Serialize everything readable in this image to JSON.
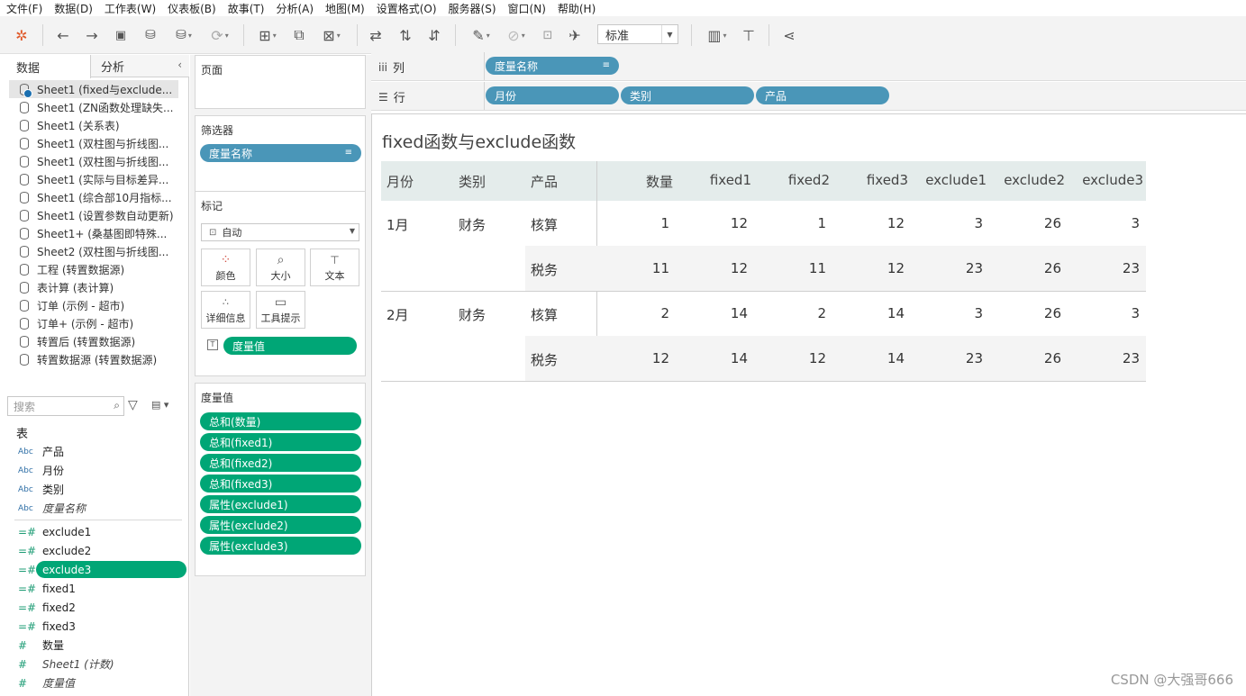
{
  "menu": [
    "文件(F)",
    "数据(D)",
    "工作表(W)",
    "仪表板(B)",
    "故事(T)",
    "分析(A)",
    "地图(M)",
    "设置格式(O)",
    "服务器(S)",
    "窗口(N)",
    "帮助(H)"
  ],
  "toolbar": {
    "fit_label": "标准"
  },
  "left": {
    "tab_data": "数据",
    "tab_analysis": "分析",
    "datasources": [
      "Sheet1 (fixed与exclude...",
      "Sheet1 (ZN函数处理缺失...",
      "Sheet1 (关系表)",
      "Sheet1 (双柱图与折线图...",
      "Sheet1 (双柱图与折线图...",
      "Sheet1 (实际与目标差异...",
      "Sheet1 (综合部10月指标...",
      "Sheet1 (设置参数自动更新)",
      "Sheet1+ (桑基图即特殊...",
      "Sheet2 (双柱图与折线图...",
      "工程 (转置数据源)",
      "表计算 (表计算)",
      "订单 (示例 - 超市)",
      "订单+ (示例 - 超市)",
      "转置后 (转置数据源)",
      "转置数据源 (转置数据源)"
    ],
    "search_placeholder": "搜索",
    "table_label": "表",
    "dims": [
      {
        "type": "Abc",
        "name": "产品"
      },
      {
        "type": "Abc",
        "name": "月份"
      },
      {
        "type": "Abc",
        "name": "类别"
      },
      {
        "type": "Abc",
        "name": "度量名称"
      }
    ],
    "measures": [
      {
        "type": "=#",
        "name": "exclude1"
      },
      {
        "type": "=#",
        "name": "exclude2"
      },
      {
        "type": "=#",
        "name": "exclude3"
      },
      {
        "type": "=#",
        "name": "fixed1"
      },
      {
        "type": "=#",
        "name": "fixed2"
      },
      {
        "type": "=#",
        "name": "fixed3"
      },
      {
        "type": "#",
        "name": "数量"
      },
      {
        "type": "#",
        "name": "Sheet1 (计数)"
      },
      {
        "type": "#",
        "name": "度量值"
      }
    ]
  },
  "mid": {
    "pages_label": "页面",
    "filters_label": "筛选器",
    "filter_pill": "度量名称",
    "marks_label": "标记",
    "marks_type": "自动",
    "mark_buttons": [
      "颜色",
      "大小",
      "文本",
      "详细信息",
      "工具提示"
    ],
    "text_pill": "度量值",
    "measure_values_label": "度量值",
    "measure_values": [
      "总和(数量)",
      "总和(fixed1)",
      "总和(fixed2)",
      "总和(fixed3)",
      "属性(exclude1)",
      "属性(exclude2)",
      "属性(exclude3)"
    ]
  },
  "shelves": {
    "columns_label": "列",
    "rows_label": "行",
    "columns_pill": "度量名称",
    "rows_pills": [
      "月份",
      "类别",
      "产品"
    ]
  },
  "viz": {
    "title": "fixed函数与exclude函数",
    "headers": [
      "月份",
      "类别",
      "产品",
      "数量",
      "fixed1",
      "fixed2",
      "fixed3",
      "exclude1",
      "exclude2",
      "exclude3"
    ],
    "rows": [
      {
        "month": "1月",
        "category": "财务",
        "product": "核算",
        "values": [
          "1",
          "12",
          "1",
          "12",
          "3",
          "26",
          "3"
        ]
      },
      {
        "month": "",
        "category": "",
        "product": "税务",
        "values": [
          "11",
          "12",
          "11",
          "12",
          "23",
          "26",
          "23"
        ]
      },
      {
        "month": "2月",
        "category": "财务",
        "product": "核算",
        "values": [
          "2",
          "14",
          "2",
          "14",
          "3",
          "26",
          "3"
        ]
      },
      {
        "month": "",
        "category": "",
        "product": "税务",
        "values": [
          "12",
          "14",
          "12",
          "14",
          "23",
          "26",
          "23"
        ]
      }
    ]
  },
  "watermark": "CSDN @大强哥666",
  "colors": {
    "blue_pill": "#4a96b8",
    "green_pill": "#00a676",
    "header_bg": "#e4eceb"
  }
}
